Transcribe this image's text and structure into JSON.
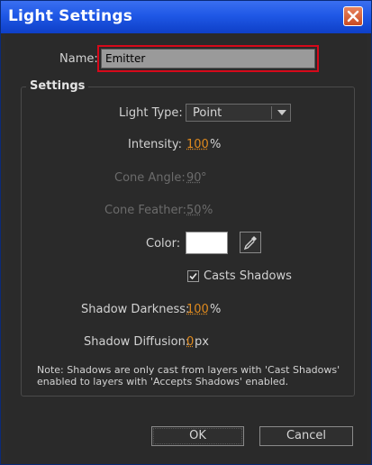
{
  "window": {
    "title": "Light Settings",
    "close_icon": "close-icon"
  },
  "name": {
    "label": "Name:",
    "value": "Emitter"
  },
  "settings": {
    "group_title": "Settings",
    "light_type": {
      "label": "Light Type:",
      "value": "Point"
    },
    "intensity": {
      "label": "Intensity:",
      "value": "100",
      "unit": "%"
    },
    "cone_angle": {
      "label": "Cone Angle:",
      "value": "90",
      "unit": "°"
    },
    "cone_feather": {
      "label": "Cone Feather:",
      "value": "50",
      "unit": "%"
    },
    "color": {
      "label": "Color:",
      "swatch": "#ffffff",
      "eyedropper_icon": "eyedropper-icon"
    },
    "casts_shadows": {
      "label": "Casts Shadows",
      "checked": true
    },
    "shadow_darkness": {
      "label": "Shadow Darkness:",
      "value": "100",
      "unit": "%"
    },
    "shadow_diffusion": {
      "label": "Shadow Diffusion:",
      "value": "0",
      "unit": "px"
    },
    "note": "Note: Shadows are only cast from layers with 'Cast Shadows' enabled to layers with 'Accepts Shadows' enabled."
  },
  "buttons": {
    "ok": "OK",
    "cancel": "Cancel"
  },
  "colors": {
    "title_bar": "#1f58e6",
    "accent_value": "#e08a1e",
    "highlight_border": "#d6091a",
    "background": "#2a2a2a"
  }
}
